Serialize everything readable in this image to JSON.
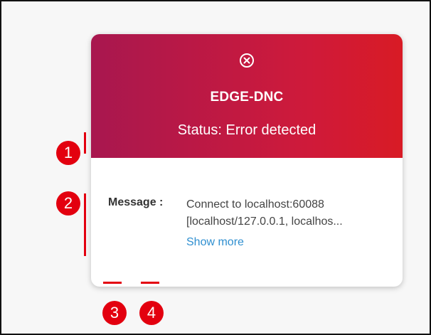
{
  "card": {
    "title": "EDGE-DNC",
    "status": "Status: Error detected",
    "header_icon": "error-circle-x-icon",
    "colors": {
      "header_start": "#a8174f",
      "header_end": "#d81b25",
      "link": "#2f8fd0"
    }
  },
  "message": {
    "label": "Message :",
    "lines": [
      "Connect to localhost:60088",
      "[localhost/127.0.0.1, localhos..."
    ],
    "show_more": "Show more"
  },
  "footer": {
    "icons": [
      "document-icon",
      "download-icon",
      "settings-gear-icon"
    ]
  },
  "annotations": {
    "color": "#e3000f",
    "badges": [
      "1",
      "2",
      "3",
      "4"
    ]
  }
}
